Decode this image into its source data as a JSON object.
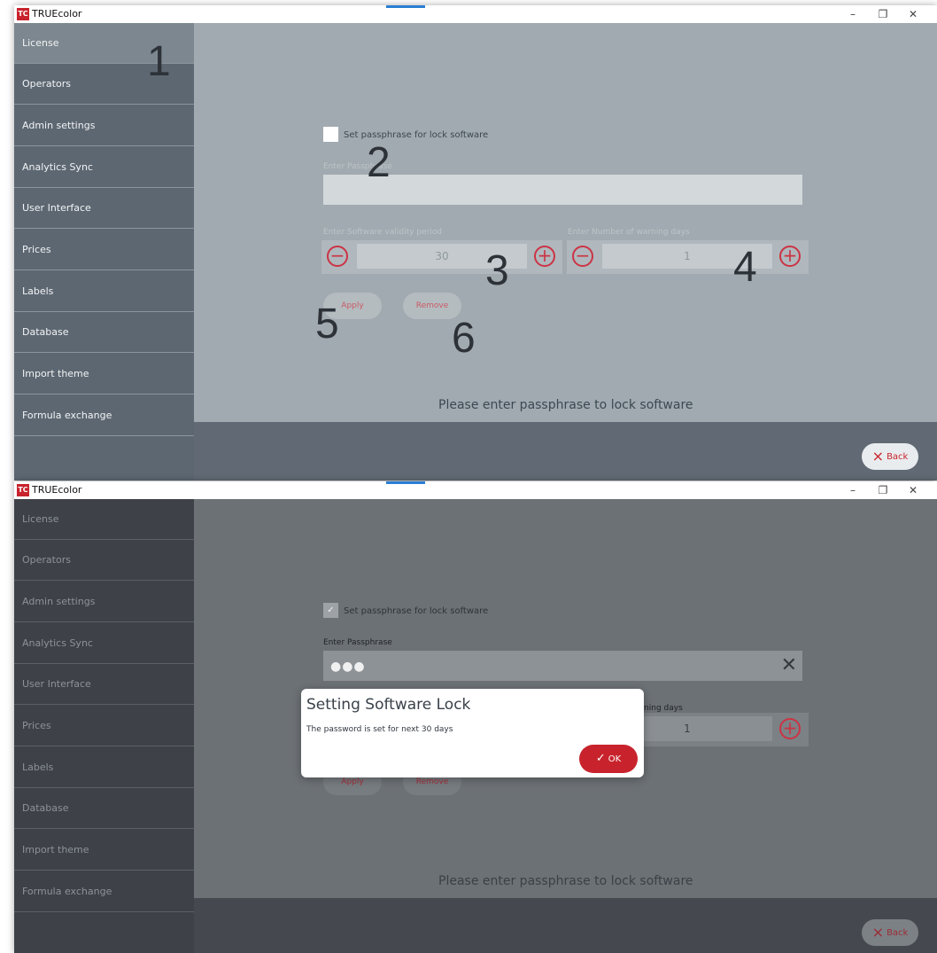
{
  "app": {
    "title": "TRUEcolor",
    "logo_text": "TC"
  },
  "window_controls": {
    "minimize": "–",
    "restore": "❐",
    "close": "✕"
  },
  "sidebar": {
    "items": [
      {
        "label": "License"
      },
      {
        "label": "Operators"
      },
      {
        "label": "Admin settings"
      },
      {
        "label": "Analytics Sync"
      },
      {
        "label": "User Interface"
      },
      {
        "label": "Prices"
      },
      {
        "label": "Labels"
      },
      {
        "label": "Database"
      },
      {
        "label": "Import theme"
      },
      {
        "label": "Formula exchange"
      }
    ]
  },
  "license_panel": {
    "lock_checkbox_label": "Set passphrase for lock software",
    "passphrase_label": "Enter Passphrase",
    "validity_label": "Enter Software validity period",
    "validity_value": "30",
    "warning_label": "Enter Number of warning days",
    "warning_value": "1",
    "apply_label": "Apply",
    "remove_label": "Remove",
    "status_message": "Please enter passphrase to lock software",
    "minus_symbol": "−",
    "plus_symbol": "+"
  },
  "footer": {
    "back_label": "Back",
    "back_icon": "×"
  },
  "annotations": {
    "a1": "1",
    "a2": "2",
    "a3": "3",
    "a4": "4",
    "a5": "5",
    "a6": "6"
  },
  "second_view": {
    "checkbox_checked": true,
    "check_mark": "✓",
    "passphrase_masked": "●●●",
    "clear_icon": "✕",
    "warning_label_fragment": "arning days",
    "dialog": {
      "title": "Setting Software Lock",
      "message": "The password is set for next 30 days",
      "ok_label": "OK",
      "ok_icon": "✓"
    }
  },
  "colors": {
    "accent": "#c8232c",
    "sidebar": "#5d6772",
    "main_bg": "#a1aab0"
  }
}
